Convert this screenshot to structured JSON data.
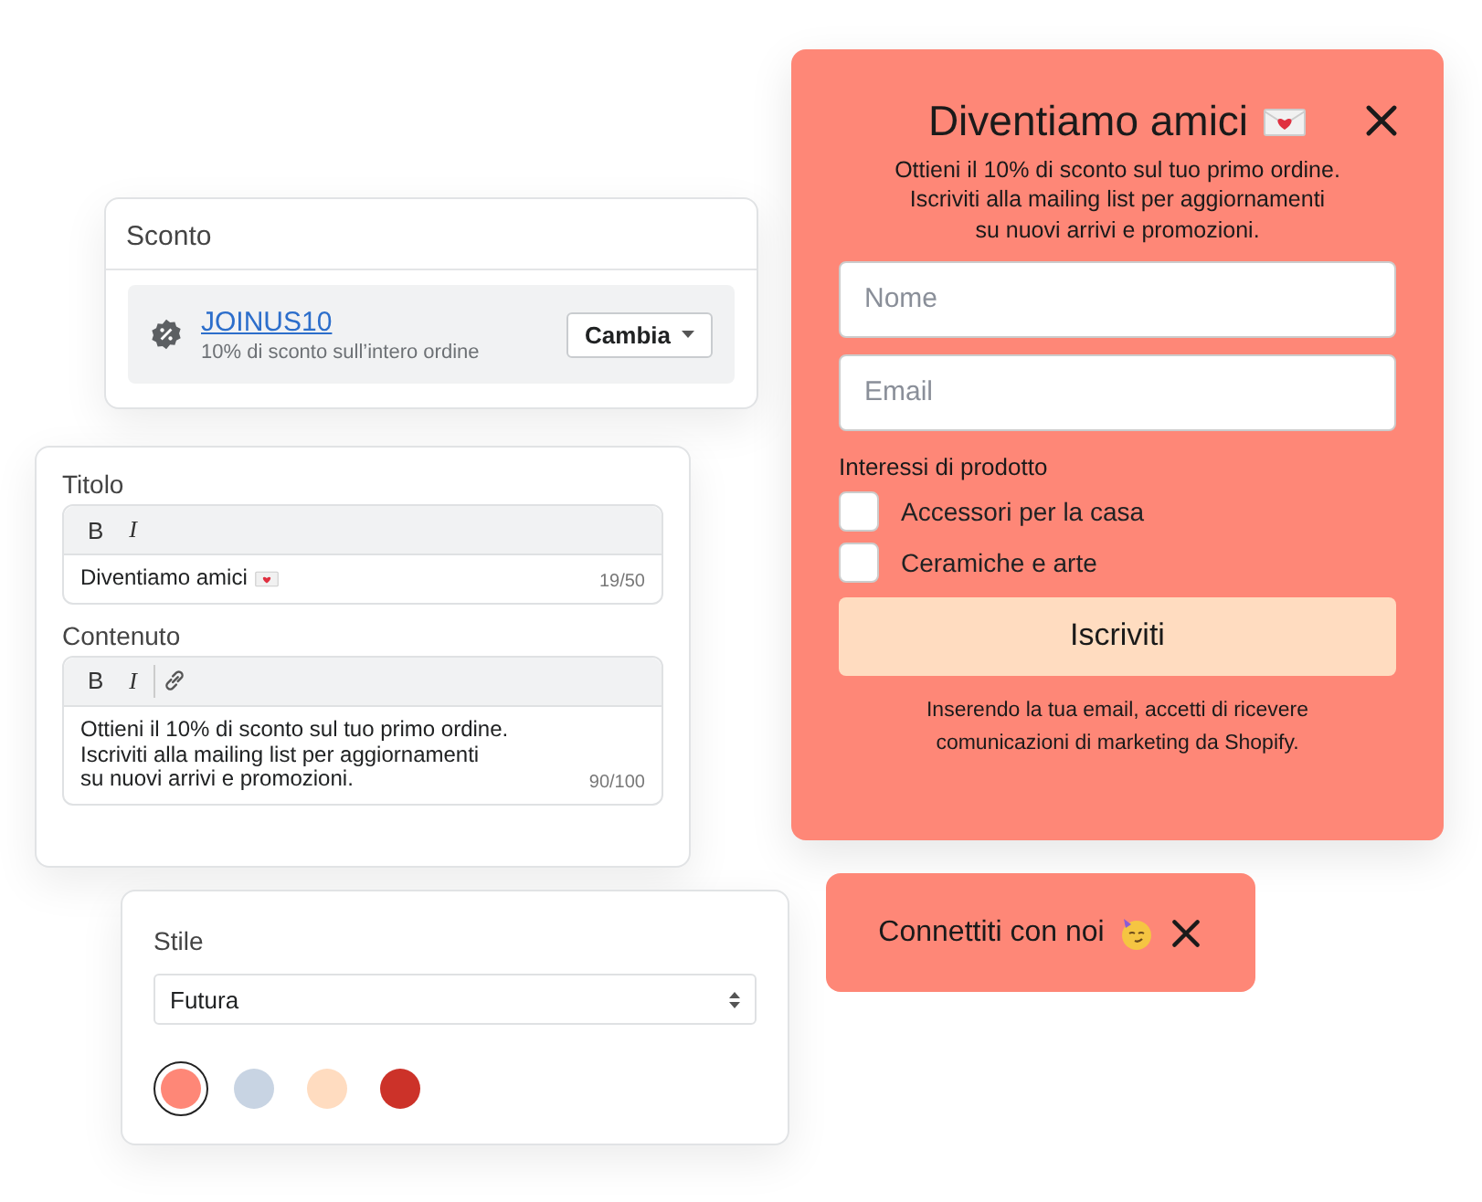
{
  "discount": {
    "heading": "Sconto",
    "code": "JOINUS10",
    "description": "10% di sconto sull’intero ordine",
    "button": "Cambia"
  },
  "editor": {
    "fields": [
      {
        "kind": "title",
        "label": "Titolo",
        "tools": [
          {
            "kind": "bold",
            "label": "B"
          },
          {
            "kind": "italic",
            "label": "I"
          }
        ],
        "value": "Diventiamo amici",
        "counter": "19/50"
      },
      {
        "kind": "body",
        "label": "Contenuto",
        "tools": [
          {
            "kind": "bold",
            "label": "B"
          },
          {
            "kind": "italic",
            "label": "I"
          },
          {
            "kind": "link"
          }
        ],
        "value": "Ottieni il 10% di sconto sul tuo primo ordine.\nIscriviti alla mailing list per aggiornamenti\nsu nuovi arrivi e promozioni.",
        "counter": "90/100"
      }
    ]
  },
  "style": {
    "heading": "Stile",
    "font": "Futura",
    "swatches": [
      {
        "color": "#fe8777",
        "selected": true
      },
      {
        "color": "#c8d4e3",
        "selected": false
      },
      {
        "color": "#ffdcc0",
        "selected": false
      },
      {
        "color": "#cc3229",
        "selected": false
      }
    ]
  },
  "popup": {
    "title": "Diventiamo amici",
    "subtitle": "Ottieni il 10% di sconto sul tuo primo ordine.\nIscriviti alla mailing list per aggiornamenti\nsu nuovi arrivi e promozioni.",
    "fields": [
      {
        "placeholder": "Nome"
      },
      {
        "placeholder": "Email"
      }
    ],
    "interests_label": "Interessi di prodotto",
    "options": [
      {
        "label": "Accessori per la casa",
        "checked": false
      },
      {
        "label": "Ceramiche e arte",
        "checked": false
      }
    ],
    "button": "Iscriviti",
    "footer": "Inserendo la tua email, accetti di ricevere\ncomunicazioni di marketing da Shopify."
  },
  "toast": {
    "text": "Connettiti con noi"
  }
}
